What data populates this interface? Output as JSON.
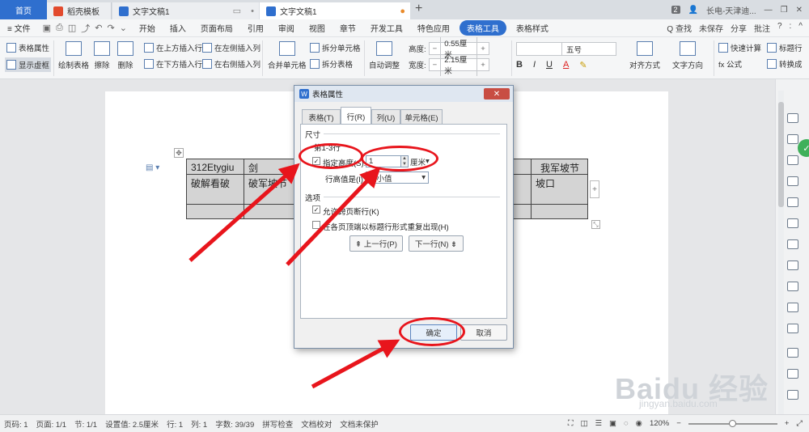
{
  "titlebar": {
    "tabs": [
      {
        "label": "首页",
        "icon": "home-tab"
      },
      {
        "label": "稻壳模板",
        "icon": "docer-logo-icon"
      },
      {
        "label": "文字文稿1",
        "icon": "wps-writer-icon"
      },
      {
        "label": "文字文稿1",
        "icon": "wps-writer-icon"
      }
    ],
    "new_tab": "+",
    "window_count": "2",
    "user": "长电-天津迪..."
  },
  "menubar": {
    "file": "≡ 文件",
    "items": [
      "开始",
      "插入",
      "页面布局",
      "引用",
      "审阅",
      "视图",
      "章节",
      "开发工具",
      "特色应用",
      "表格工具",
      "表格样式"
    ],
    "right": [
      "Q 查找",
      "未保存",
      "分享",
      "批注",
      "?",
      ":",
      "^"
    ]
  },
  "ribbon": {
    "table_props": "表格属性",
    "show_gridlines": "显示虚框",
    "draw_table": "绘制表格",
    "erase": "擦除",
    "delete": "删除",
    "insert_above": "在上方插入行",
    "insert_below": "在下方插入行",
    "insert_left": "在左侧插入列",
    "insert_right": "在右侧插入列",
    "merge_cells": "合并单元格",
    "split_cells": "拆分单元格",
    "split_table": "拆分表格",
    "auto_fit": "自动调整",
    "height_label": "高度:",
    "height_value": "0.55厘米",
    "width_label": "宽度:",
    "width_value": "2.15厘米",
    "font_size": "五号",
    "bold": "B",
    "italic": "I",
    "underline": "U",
    "font_color": "A",
    "align": "对齐方式",
    "text_dir": "文字方向",
    "quick_calc": "快速计算",
    "formula": "fx 公式",
    "title_row": "标题行",
    "convert": "转换成"
  },
  "table": {
    "rows": [
      [
        "312Etygiu",
        "剑",
        "",
        "我军坡节"
      ],
      [
        "破解看破",
        "破军坡节",
        "",
        "坡口"
      ],
      [
        "",
        "",
        "",
        ""
      ]
    ]
  },
  "dialog": {
    "title": "表格属性",
    "close": "✕",
    "tabs": [
      "表格(T)",
      "行(R)",
      "列(U)",
      "单元格(E)"
    ],
    "section_size": "尺寸",
    "row_label": "第1-3行",
    "specify_height": "指定高度(S):",
    "height_value": "1",
    "unit": "厘米",
    "row_height_rule_label": "行高值是(I):",
    "row_height_rule": "最小值",
    "section_options": "选项",
    "allow_break": "允许跨页断行(K)",
    "repeat_header": "在各页顶端以标题行形式重复出现(H)",
    "prev_row": "⇞ 上一行(P)",
    "next_row": "下一行(N) ⇟",
    "ok": "确定",
    "cancel": "取消"
  },
  "statusbar": {
    "items": [
      "页码: 1",
      "页面: 1/1",
      "节: 1/1",
      "设置值: 2.5厘米",
      "行: 1",
      "列: 1",
      "字数: 39/39",
      "拼写检查",
      "文档校对",
      "文档未保护"
    ],
    "zoom": "120%",
    "zoom_level": 0.5
  },
  "watermark": {
    "text": "Baidu 经验",
    "url": "jingyan.baidu.com"
  },
  "colors": {
    "accent": "#2f6fce",
    "annotation": "#e8151c",
    "status_ok": "#3fb05a"
  }
}
